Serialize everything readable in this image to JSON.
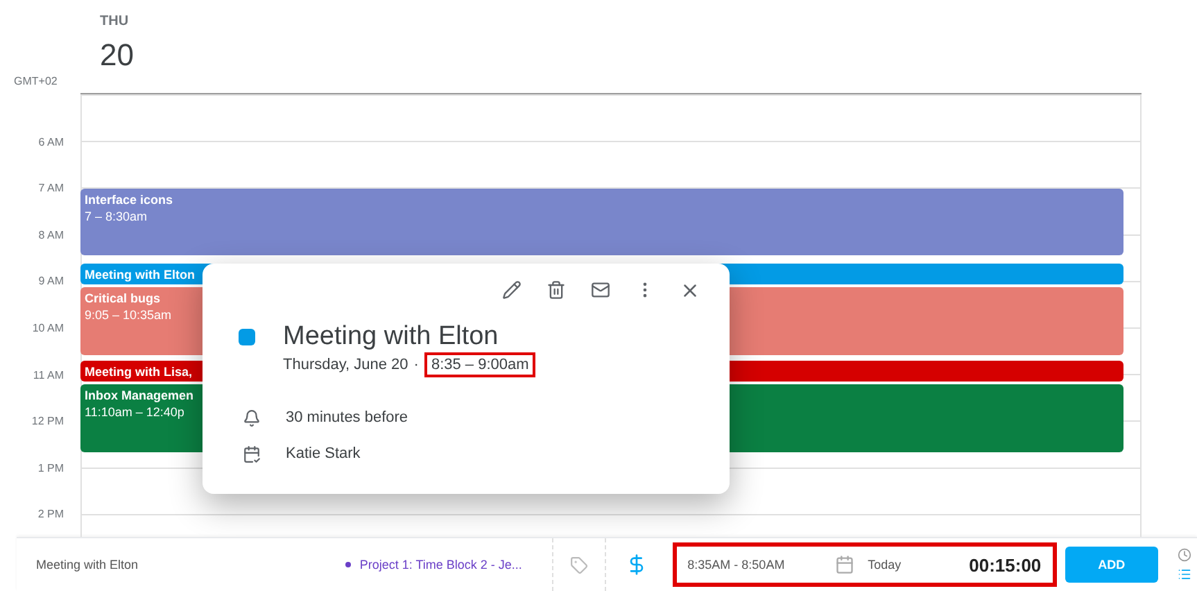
{
  "day": {
    "weekday": "THU",
    "date": "20"
  },
  "timezone": "GMT+02",
  "hours": [
    "6 AM",
    "7 AM",
    "8 AM",
    "9 AM",
    "10 AM",
    "11 AM",
    "12 PM",
    "1 PM",
    "2 PM"
  ],
  "events": [
    {
      "title": "Interface icons",
      "time": "7 – 8:30am",
      "color": "#7986cb"
    },
    {
      "title": "Meeting with Elton",
      "color": "#039be5"
    },
    {
      "title": "Critical bugs",
      "time": "9:05 – 10:35am",
      "color": "#e67c73"
    },
    {
      "title": "Meeting with Lisa,",
      "color": "#d50000"
    },
    {
      "title": "Inbox Managemen",
      "time": "11:10am – 12:40p",
      "color": "#0b8043"
    }
  ],
  "popup": {
    "title": "Meeting with Elton",
    "color": "#039be5",
    "date": "Thursday, June 20",
    "separator": "·",
    "time": "8:35 – 9:00am",
    "time_highlighted": true,
    "reminder": "30 minutes before",
    "calendar": "Katie Stark"
  },
  "timer": {
    "description": "Meeting with Elton",
    "project": {
      "name": "Project 1: Time Block 2 - Je...",
      "color": "#6a3fc7"
    },
    "time_range": "8:35AM - 8:50AM",
    "date": "Today",
    "duration": "00:15:00",
    "highlighted": true,
    "add_button": "ADD"
  }
}
